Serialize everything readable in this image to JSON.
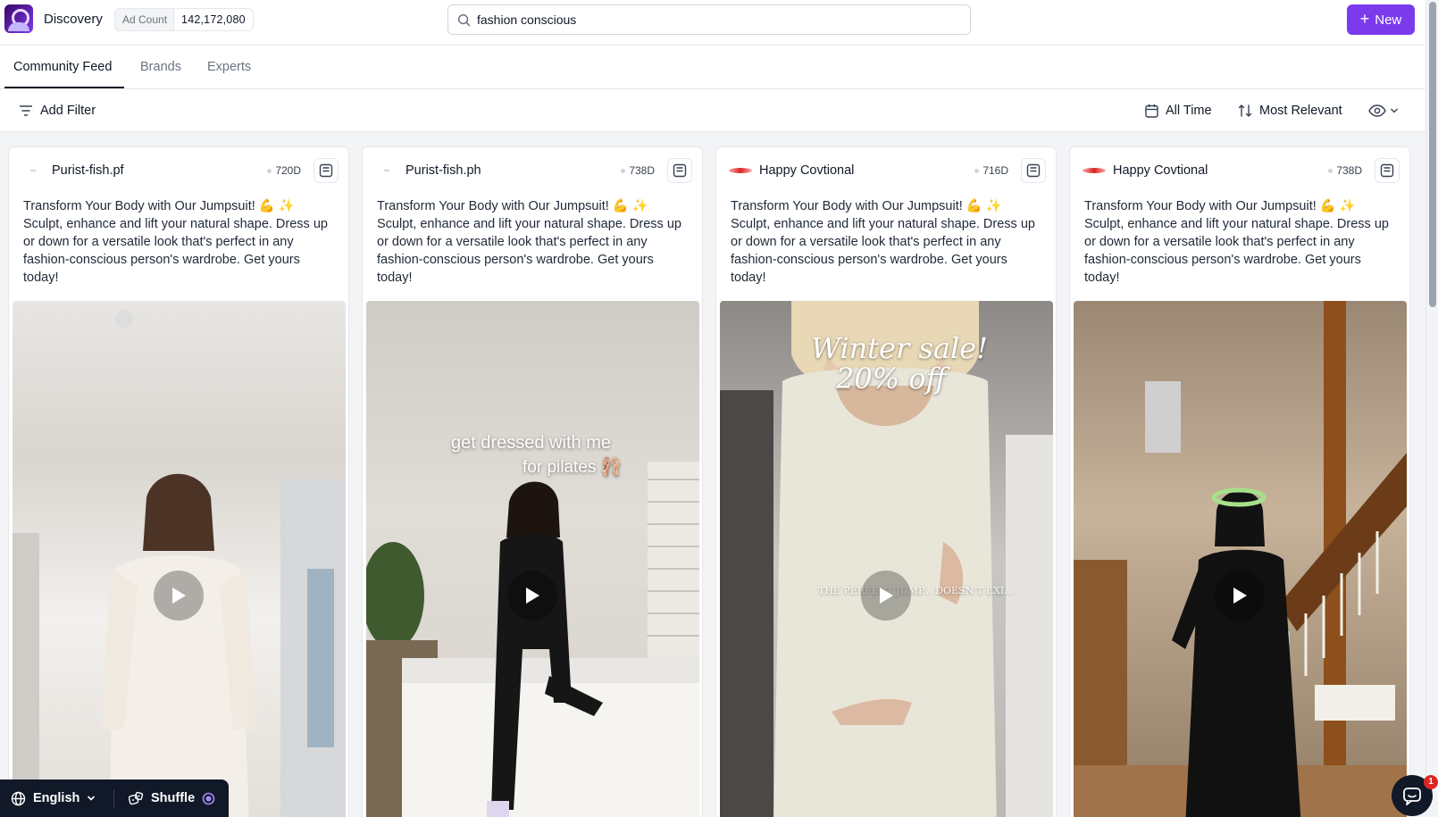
{
  "header": {
    "app_name": "Discovery",
    "ad_count_label": "Ad Count",
    "ad_count_value": "142,172,080",
    "search_value": "fashion conscious",
    "new_button_label": "New"
  },
  "tabs": [
    {
      "label": "Community Feed",
      "active": true
    },
    {
      "label": "Brands",
      "active": false
    },
    {
      "label": "Experts",
      "active": false
    }
  ],
  "filters": {
    "add_filter_label": "Add Filter",
    "time_label": "All Time",
    "sort_label": "Most Relevant"
  },
  "cards": [
    {
      "brand": "Purist-fish.pf",
      "logo": "dash-logo",
      "age": "720D",
      "caption": "Transform Your Body with Our Jumpsuit! 💪 ✨ Sculpt, enhance and lift your natural shape. Dress up or down for a versatile look that's perfect in any fashion-conscious person's wardrobe. Get yours today!",
      "overlay": ""
    },
    {
      "brand": "Purist-fish.ph",
      "logo": "dash-logo",
      "age": "738D",
      "caption": "Transform Your Body with Our Jumpsuit! 💪 ✨ Sculpt, enhance and lift your natural shape. Dress up or down for a versatile look that's perfect in any fashion-conscious person's wardrobe. Get yours today!",
      "overlay_line1": "get dressed with me",
      "overlay_line2": "for pilates 🩰"
    },
    {
      "brand": "Happy Covtional",
      "logo": "lips-logo",
      "age": "716D",
      "caption": "Transform Your Body with Our Jumpsuit! 💪 ✨ Sculpt, enhance and lift your natural shape. Dress up or down for a versatile look that's perfect in any fashion-conscious person's wardrobe. Get yours today!",
      "overlay_line1": "Winter sale!",
      "overlay_line2": "20% off",
      "overlay_small": "THE PERFECT JUMP... DOESN'T EXI..."
    },
    {
      "brand": "Happy Covtional",
      "logo": "lips-logo",
      "age": "738D",
      "caption": "Transform Your Body with Our Jumpsuit! 💪 ✨ Sculpt, enhance and lift your natural shape. Dress up or down for a versatile look that's perfect in any fashion-conscious person's wardrobe. Get yours today!",
      "overlay": ""
    }
  ],
  "bottom": {
    "language_label": "English",
    "shuffle_label": "Shuffle",
    "chat_badge": "1"
  },
  "colors": {
    "accent": "#7c3aed",
    "dark": "#111827",
    "badge": "#dc2626"
  }
}
